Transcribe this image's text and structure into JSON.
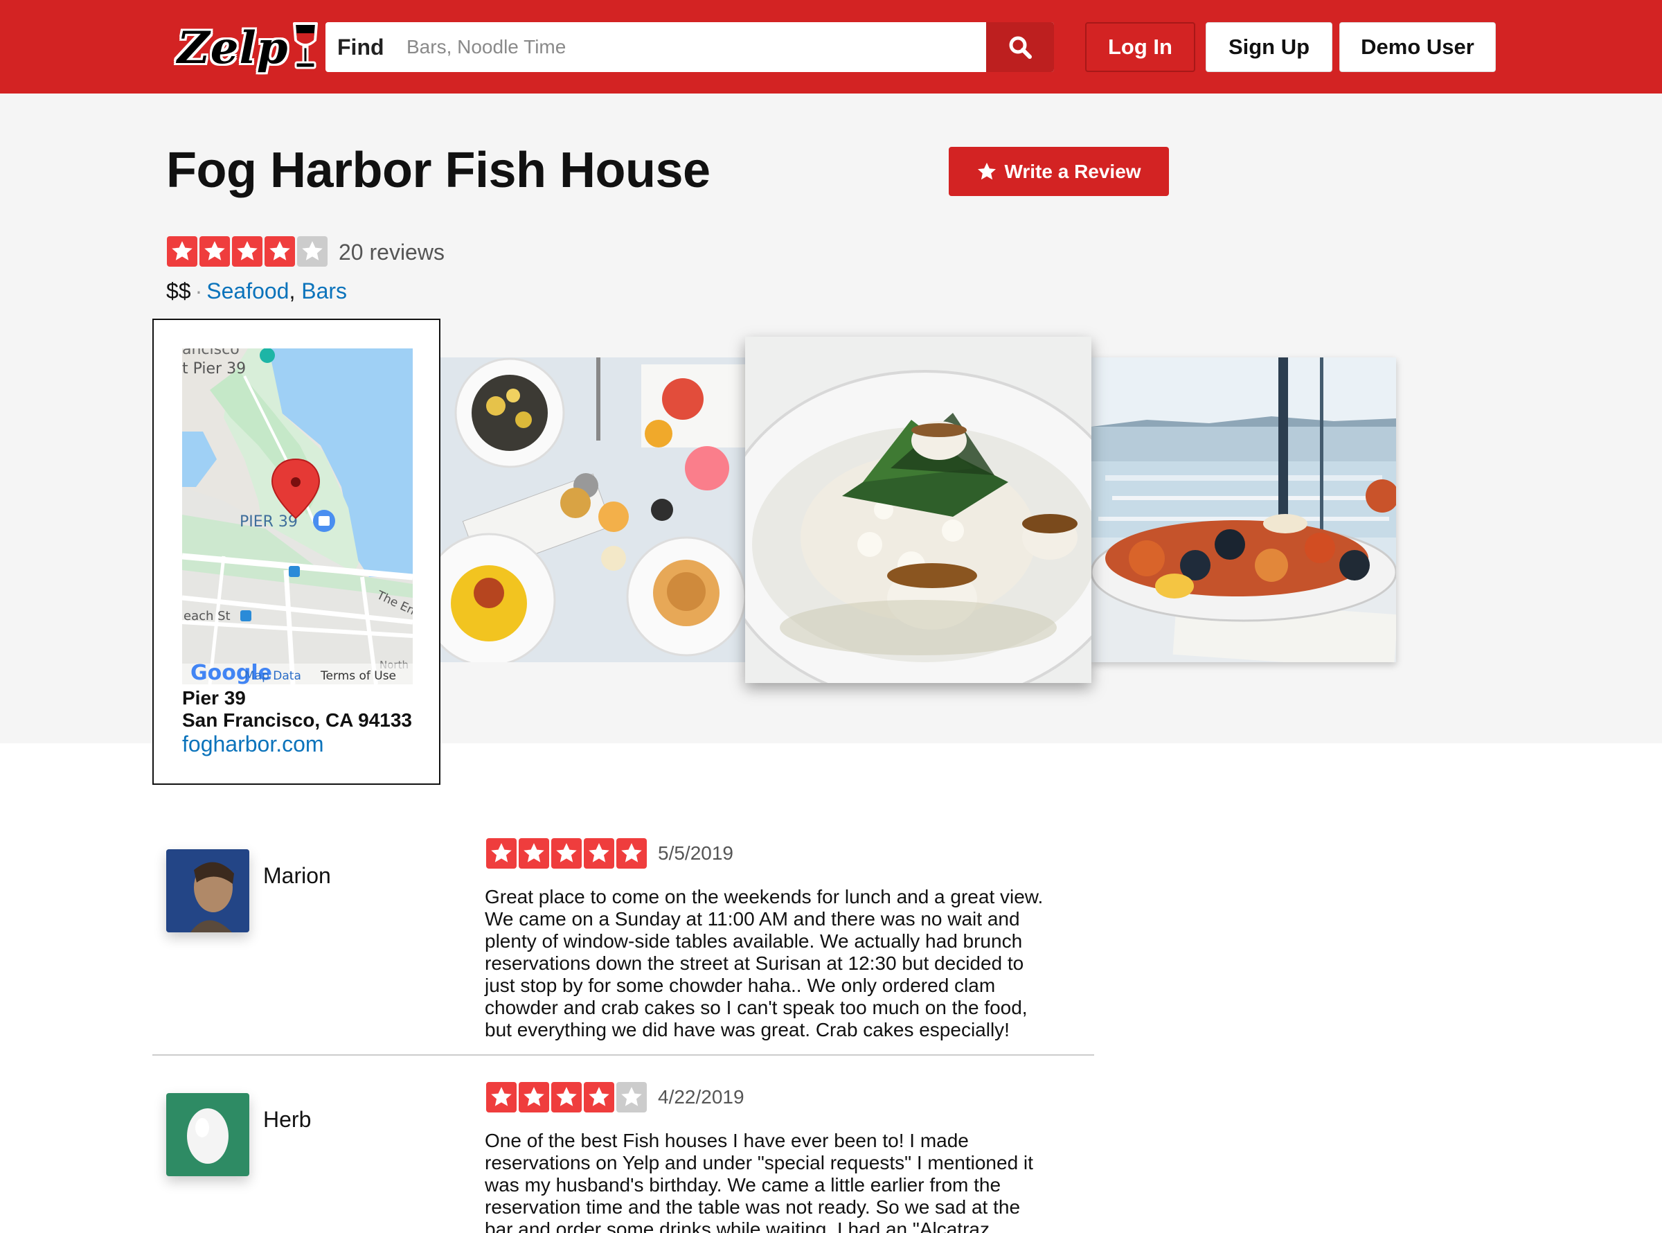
{
  "header": {
    "logo_text": "Zelp",
    "search_label": "Find",
    "search_placeholder": "Bars, Noodle Time",
    "login_label": "Log In",
    "signup_label": "Sign Up",
    "demo_label": "Demo User",
    "brand_color": "#d32323"
  },
  "business": {
    "name": "Fog Harbor Fish House",
    "write_review_label": "Write a Review",
    "rating": 4,
    "review_count": "20 reviews",
    "price": "$$",
    "separator": "·",
    "categories": [
      "Seafood",
      "Bars"
    ],
    "category_comma": ",",
    "address_line1": "Pier 39",
    "address_line2": "San Francisco, CA 94133",
    "website": "fogharbor.com"
  },
  "map": {
    "label_city": "ancisco",
    "label_pier_top": "t Pier 39",
    "label_pier": "PIER 39",
    "label_beach": "each St",
    "label_embarcadero": "The En",
    "label_north": "North",
    "google": "Google",
    "map_data": "Map Data",
    "terms": "Terms of Use"
  },
  "photos": [
    {
      "name": "seafood-table-photo"
    },
    {
      "name": "scallop-risotto-photo"
    },
    {
      "name": "seafood-platter-harbor-photo"
    }
  ],
  "reviews": [
    {
      "name": "Marion",
      "rating": 5,
      "date": "5/5/2019",
      "lines": [
        "Great place to come on the weekends for lunch and a great view.",
        "We came on a Sunday at 11:00 AM and there was no wait and",
        "plenty of window-side tables available. We actually had brunch",
        "reservations down the street at Surisan at 12:30 but decided to",
        "just stop by for some chowder haha.. We only ordered clam",
        "chowder and crab cakes so I can't speak too much on the food,",
        "but everything we did have was great. Crab cakes especially!"
      ]
    },
    {
      "name": "Herb",
      "rating": 4,
      "date": "4/22/2019",
      "lines": [
        "One of the best Fish houses I have ever been to! I made",
        "reservations on Yelp and under \"special requests\" I mentioned it",
        "was my husband's birthday. We came a little earlier from the",
        "reservation time and the table was not ready. So we sad at the",
        "bar and order some drinks while waiting. I had an \"Alcatraz"
      ]
    }
  ]
}
